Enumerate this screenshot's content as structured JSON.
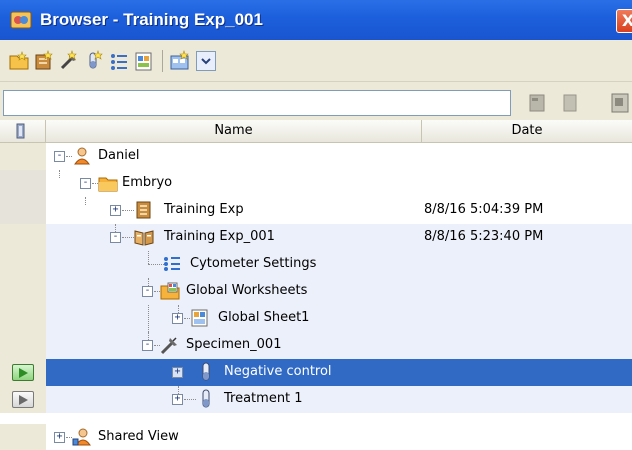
{
  "window": {
    "title": "Browser - Training Exp_001",
    "close_label": "X"
  },
  "toolbar": {
    "buttons": [
      "new-folder-icon",
      "new-experiment-icon",
      "new-specimen-icon",
      "new-tube-icon",
      "new-settings-icon",
      "new-worksheet-icon",
      "new-global-worksheet-icon"
    ],
    "dropdown_icon": "chevron-down-icon"
  },
  "search": {
    "value": "",
    "placeholder": ""
  },
  "columns": {
    "name": "Name",
    "date": "Date"
  },
  "tree": [
    {
      "label": "Daniel",
      "date": "",
      "icon": "user-icon",
      "expander": "-"
    },
    {
      "label": "Embryo",
      "date": "",
      "icon": "folder-icon",
      "expander": "-"
    },
    {
      "label": "Training Exp",
      "date": "8/8/16 5:04:39 PM",
      "icon": "experiment-icon",
      "expander": "+"
    },
    {
      "label": "Training Exp_001",
      "date": "8/8/16 5:23:40 PM",
      "icon": "open-experiment-icon",
      "expander": "-"
    },
    {
      "label": "Cytometer Settings",
      "date": "",
      "icon": "cytometer-settings-icon",
      "expander": ""
    },
    {
      "label": "Global Worksheets",
      "date": "",
      "icon": "worksheet-folder-icon",
      "expander": "-"
    },
    {
      "label": "Global Sheet1",
      "date": "",
      "icon": "global-sheet-icon",
      "expander": "+"
    },
    {
      "label": "Specimen_001",
      "date": "",
      "icon": "specimen-icon",
      "expander": "-"
    },
    {
      "label": "Negative control",
      "date": "",
      "icon": "tube-icon",
      "expander": "+"
    },
    {
      "label": "Treatment 1",
      "date": "",
      "icon": "tube-icon",
      "expander": "+"
    },
    {
      "label": "Shared View",
      "date": "",
      "icon": "shared-user-icon",
      "expander": "+"
    }
  ],
  "colors": {
    "titlebar": "#1c5fdc",
    "selection": "#316ac5",
    "row_tint": "#ecf0fa"
  }
}
